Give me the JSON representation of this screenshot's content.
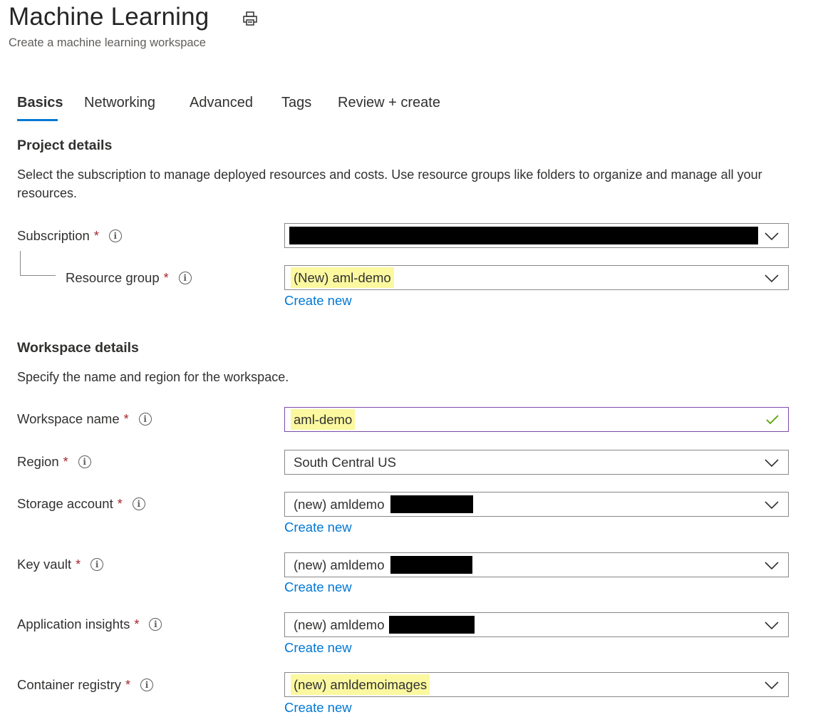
{
  "header": {
    "title": "Machine Learning",
    "subtitle": "Create a machine learning workspace",
    "print_icon": "print-icon"
  },
  "tabs": [
    {
      "label": "Basics",
      "active": true
    },
    {
      "label": "Networking",
      "active": false
    },
    {
      "label": "Advanced",
      "active": false
    },
    {
      "label": "Tags",
      "active": false
    },
    {
      "label": "Review + create",
      "active": false
    }
  ],
  "project_details": {
    "heading": "Project details",
    "description": "Select the subscription to manage deployed resources and costs. Use resource groups like folders to organize and manage all your resources.",
    "subscription": {
      "label": "Subscription",
      "required": "*",
      "value": ""
    },
    "resource_group": {
      "label": "Resource group",
      "required": "*",
      "value": "(New) aml-demo",
      "create_new": "Create new"
    }
  },
  "workspace_details": {
    "heading": "Workspace details",
    "description": "Specify the name and region for the workspace.",
    "workspace_name": {
      "label": "Workspace name",
      "required": "*",
      "value": "aml-demo"
    },
    "region": {
      "label": "Region",
      "required": "*",
      "value": "South Central US"
    },
    "storage_account": {
      "label": "Storage account",
      "required": "*",
      "value": "(new) amldemo",
      "create_new": "Create new"
    },
    "key_vault": {
      "label": "Key vault",
      "required": "*",
      "value": "(new) amldemo",
      "create_new": "Create new"
    },
    "application_insights": {
      "label": "Application insights",
      "required": "*",
      "value": "(new) amldemo",
      "create_new": "Create new"
    },
    "container_registry": {
      "label": "Container registry",
      "required": "*",
      "value": "(new) amldemoimages",
      "create_new": "Create new"
    }
  },
  "colors": {
    "accent": "#0078d4",
    "required": "#a4262c",
    "highlight": "#fbf8a0",
    "valid_check": "#57a300",
    "focus_border": "#7a4aa8"
  }
}
